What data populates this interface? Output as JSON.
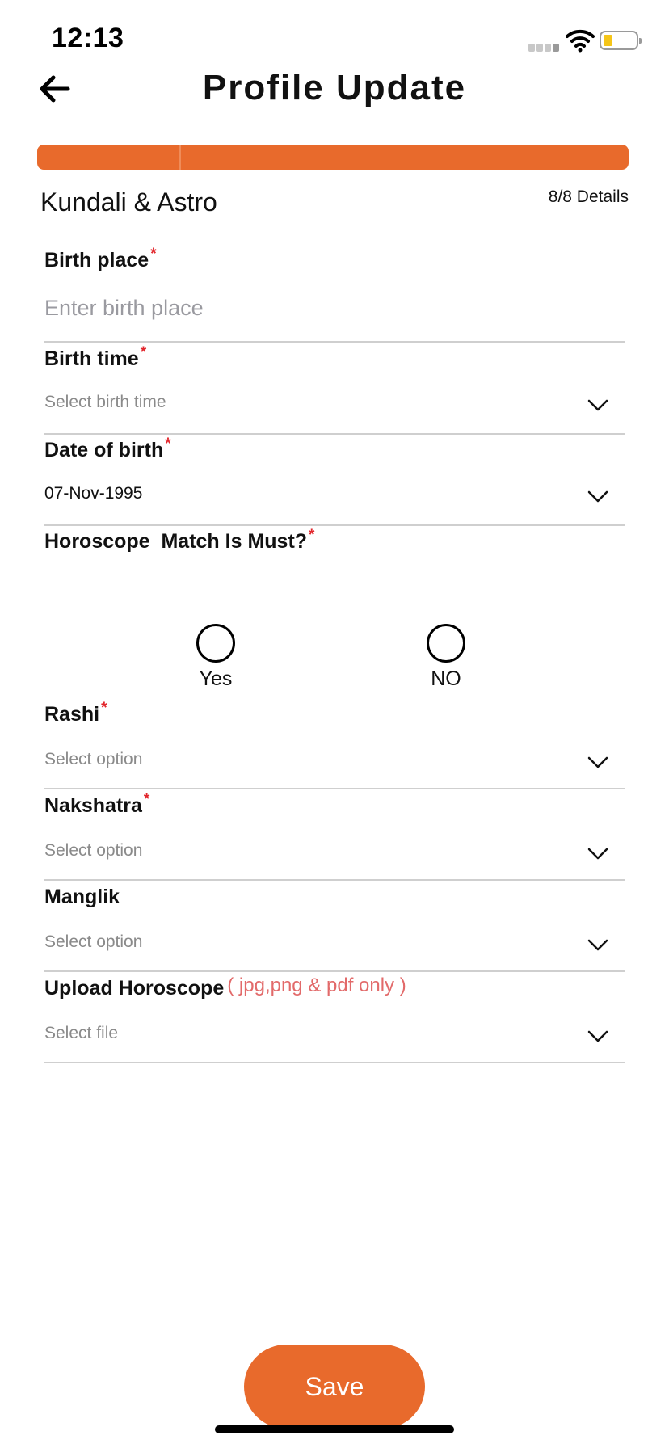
{
  "status": {
    "time": "12:13"
  },
  "header": {
    "title": "Profile Update"
  },
  "progress": {
    "fraction": 1.0
  },
  "section": {
    "title": "Kundali & Astro",
    "details": "8/8 Details"
  },
  "fields": {
    "birth_place": {
      "label": "Birth place",
      "required_mark": "*",
      "placeholder": "Enter birth place"
    },
    "birth_time": {
      "label": "Birth time",
      "required_mark": "*",
      "value": "Select birth time"
    },
    "dob": {
      "label": "Date of birth",
      "required_mark": "*",
      "value": "07-Nov-1995"
    },
    "horoscope_match": {
      "label": "Horoscope  Match Is Must?",
      "required_mark": "*",
      "options": [
        "Yes",
        "NO"
      ]
    },
    "rashi": {
      "label": "Rashi",
      "required_mark": "*",
      "value": "Select option"
    },
    "nakshatra": {
      "label": "Nakshatra",
      "required_mark": "*",
      "value": "Select option"
    },
    "manglik": {
      "label": "Manglik",
      "value": "Select option"
    },
    "upload": {
      "label": "Upload Horoscope",
      "hint": "( jpg,png & pdf only )",
      "value": "Select file"
    }
  },
  "actions": {
    "save_label": "Save"
  },
  "colors": {
    "accent": "#e86a2c",
    "required": "#e2262c",
    "hint": "#e26a6a"
  },
  "icons": {
    "back": "arrow-left-icon",
    "dropdown": "chevron-down-icon",
    "wifi": "wifi-icon",
    "battery": "battery-icon",
    "signal": "signal-icon"
  }
}
